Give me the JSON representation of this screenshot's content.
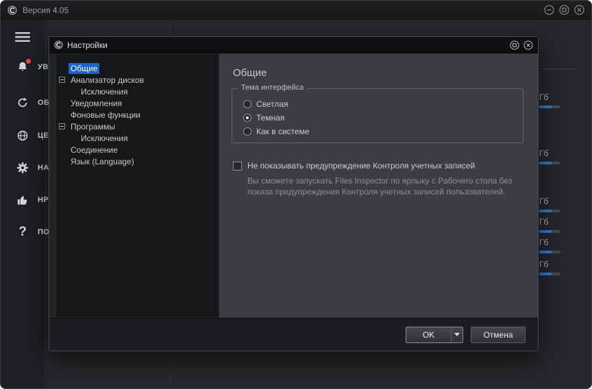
{
  "window": {
    "title": "Версия 4.05"
  },
  "icons": {
    "help_glyph": "?"
  },
  "sidebar": {
    "items": [
      {
        "name": "menu",
        "label": ""
      },
      {
        "name": "notifications",
        "label": "УВ",
        "badge": true
      },
      {
        "name": "update",
        "label": "ОБ"
      },
      {
        "name": "center",
        "label": "ЦЕ"
      },
      {
        "name": "settings",
        "label": "НА"
      },
      {
        "name": "rate",
        "label": "НР"
      },
      {
        "name": "help",
        "label": "ПО"
      }
    ]
  },
  "background": {
    "rows": [
      {
        "size": "Гб"
      },
      {
        "size": "Гб"
      },
      {
        "size": "Гб"
      },
      {
        "size": "Гб"
      },
      {
        "size": "Гб"
      },
      {
        "size": "Гб"
      }
    ]
  },
  "dialog": {
    "title": "Настройки",
    "tree": {
      "items": [
        {
          "label": "Общие",
          "selected": true
        },
        {
          "label": "Анализатор дисков",
          "expandable": true
        },
        {
          "label": "Исключения",
          "child": true
        },
        {
          "label": "Уведомления"
        },
        {
          "label": "Фоновые функции"
        },
        {
          "label": "Программы",
          "expandable": true
        },
        {
          "label": "Исключения",
          "child": true
        },
        {
          "label": "Соединение"
        },
        {
          "label": "Язык (Language)"
        }
      ]
    },
    "content": {
      "heading": "Общие",
      "theme_group": {
        "legend": "Тема интерфейса",
        "options": [
          {
            "label": "Светлая",
            "selected": false
          },
          {
            "label": "Темная",
            "selected": true
          },
          {
            "label": "Как в системе",
            "selected": false
          }
        ]
      },
      "uac": {
        "label": "Не показывать предупреждение Контроля учетных записей",
        "checked": false,
        "description": "Вы сможете запускать Files Inspector по ярлыку с Рабочего стола без показа предупреждения Контроля учетных записей пользователей."
      }
    },
    "footer": {
      "ok": "OK",
      "cancel": "Отмена"
    }
  },
  "colors": {
    "accent": "#2e7cd6",
    "selection": "#1a63c8",
    "badge": "#e14b40"
  }
}
